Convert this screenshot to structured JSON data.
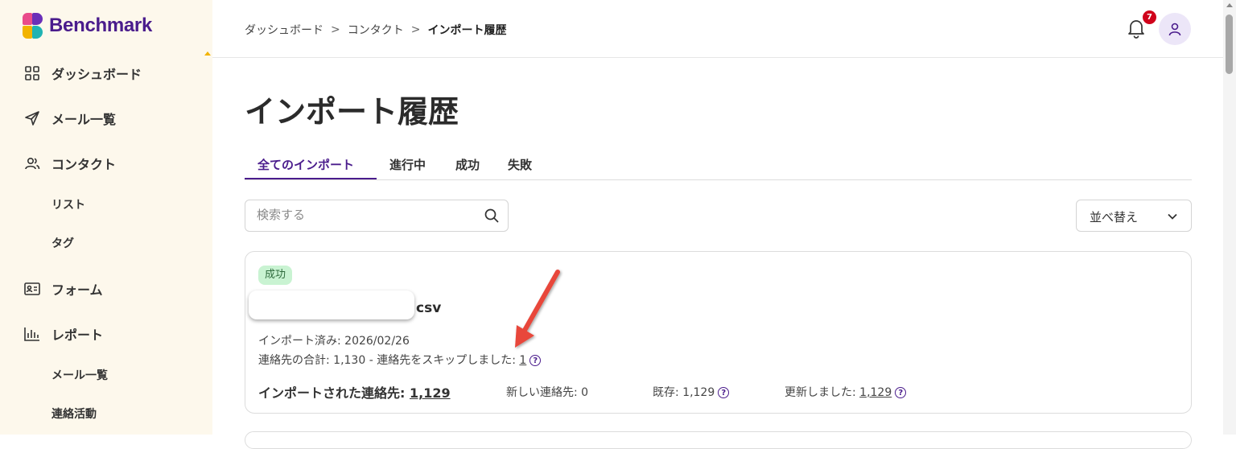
{
  "app": {
    "logo_text": "Benchmark"
  },
  "sidebar": {
    "items": [
      {
        "label": "ダッシュボード",
        "icon": "grid-icon"
      },
      {
        "label": "メール一覧",
        "icon": "send-icon"
      },
      {
        "label": "コンタクト",
        "icon": "users-icon"
      },
      {
        "label": "リスト"
      },
      {
        "label": "タグ"
      },
      {
        "label": "フォーム",
        "icon": "id-card-icon"
      },
      {
        "label": "レポート",
        "icon": "bar-chart-icon"
      },
      {
        "label": "メール一覧"
      },
      {
        "label": "連絡活動"
      }
    ]
  },
  "header": {
    "breadcrumb": [
      "ダッシュボード",
      "コンタクト",
      "インポート履歴"
    ],
    "separator": ">",
    "notification_count": "7"
  },
  "main": {
    "title": "インポート履歴",
    "tabs": [
      "全てのインポート",
      "進行中",
      "成功",
      "失敗"
    ],
    "search_placeholder": "検索する",
    "sort_label": "並べ替え"
  },
  "card": {
    "status": "成功",
    "file_ext": "csv",
    "imported_label": "インポート済み: 2026/02/26",
    "total_label": "連絡先の合計: 1,130 - 連絡先をスキップしました: ",
    "skipped_value": "1",
    "imported_contacts_label": "インポートされた連絡先: ",
    "imported_contacts_value": "1,129",
    "new_contacts": "新しい連絡先: 0",
    "existing_label": "既存: 1,129",
    "updated_label": "更新しました: ",
    "updated_value": "1,129"
  },
  "colors": {
    "brand": "#4a1c8c",
    "sidebar_bg": "#fdf8ec",
    "success_bg": "#c9f3d2",
    "badge": "#d0021b",
    "annotation_arrow": "#e8463a"
  }
}
